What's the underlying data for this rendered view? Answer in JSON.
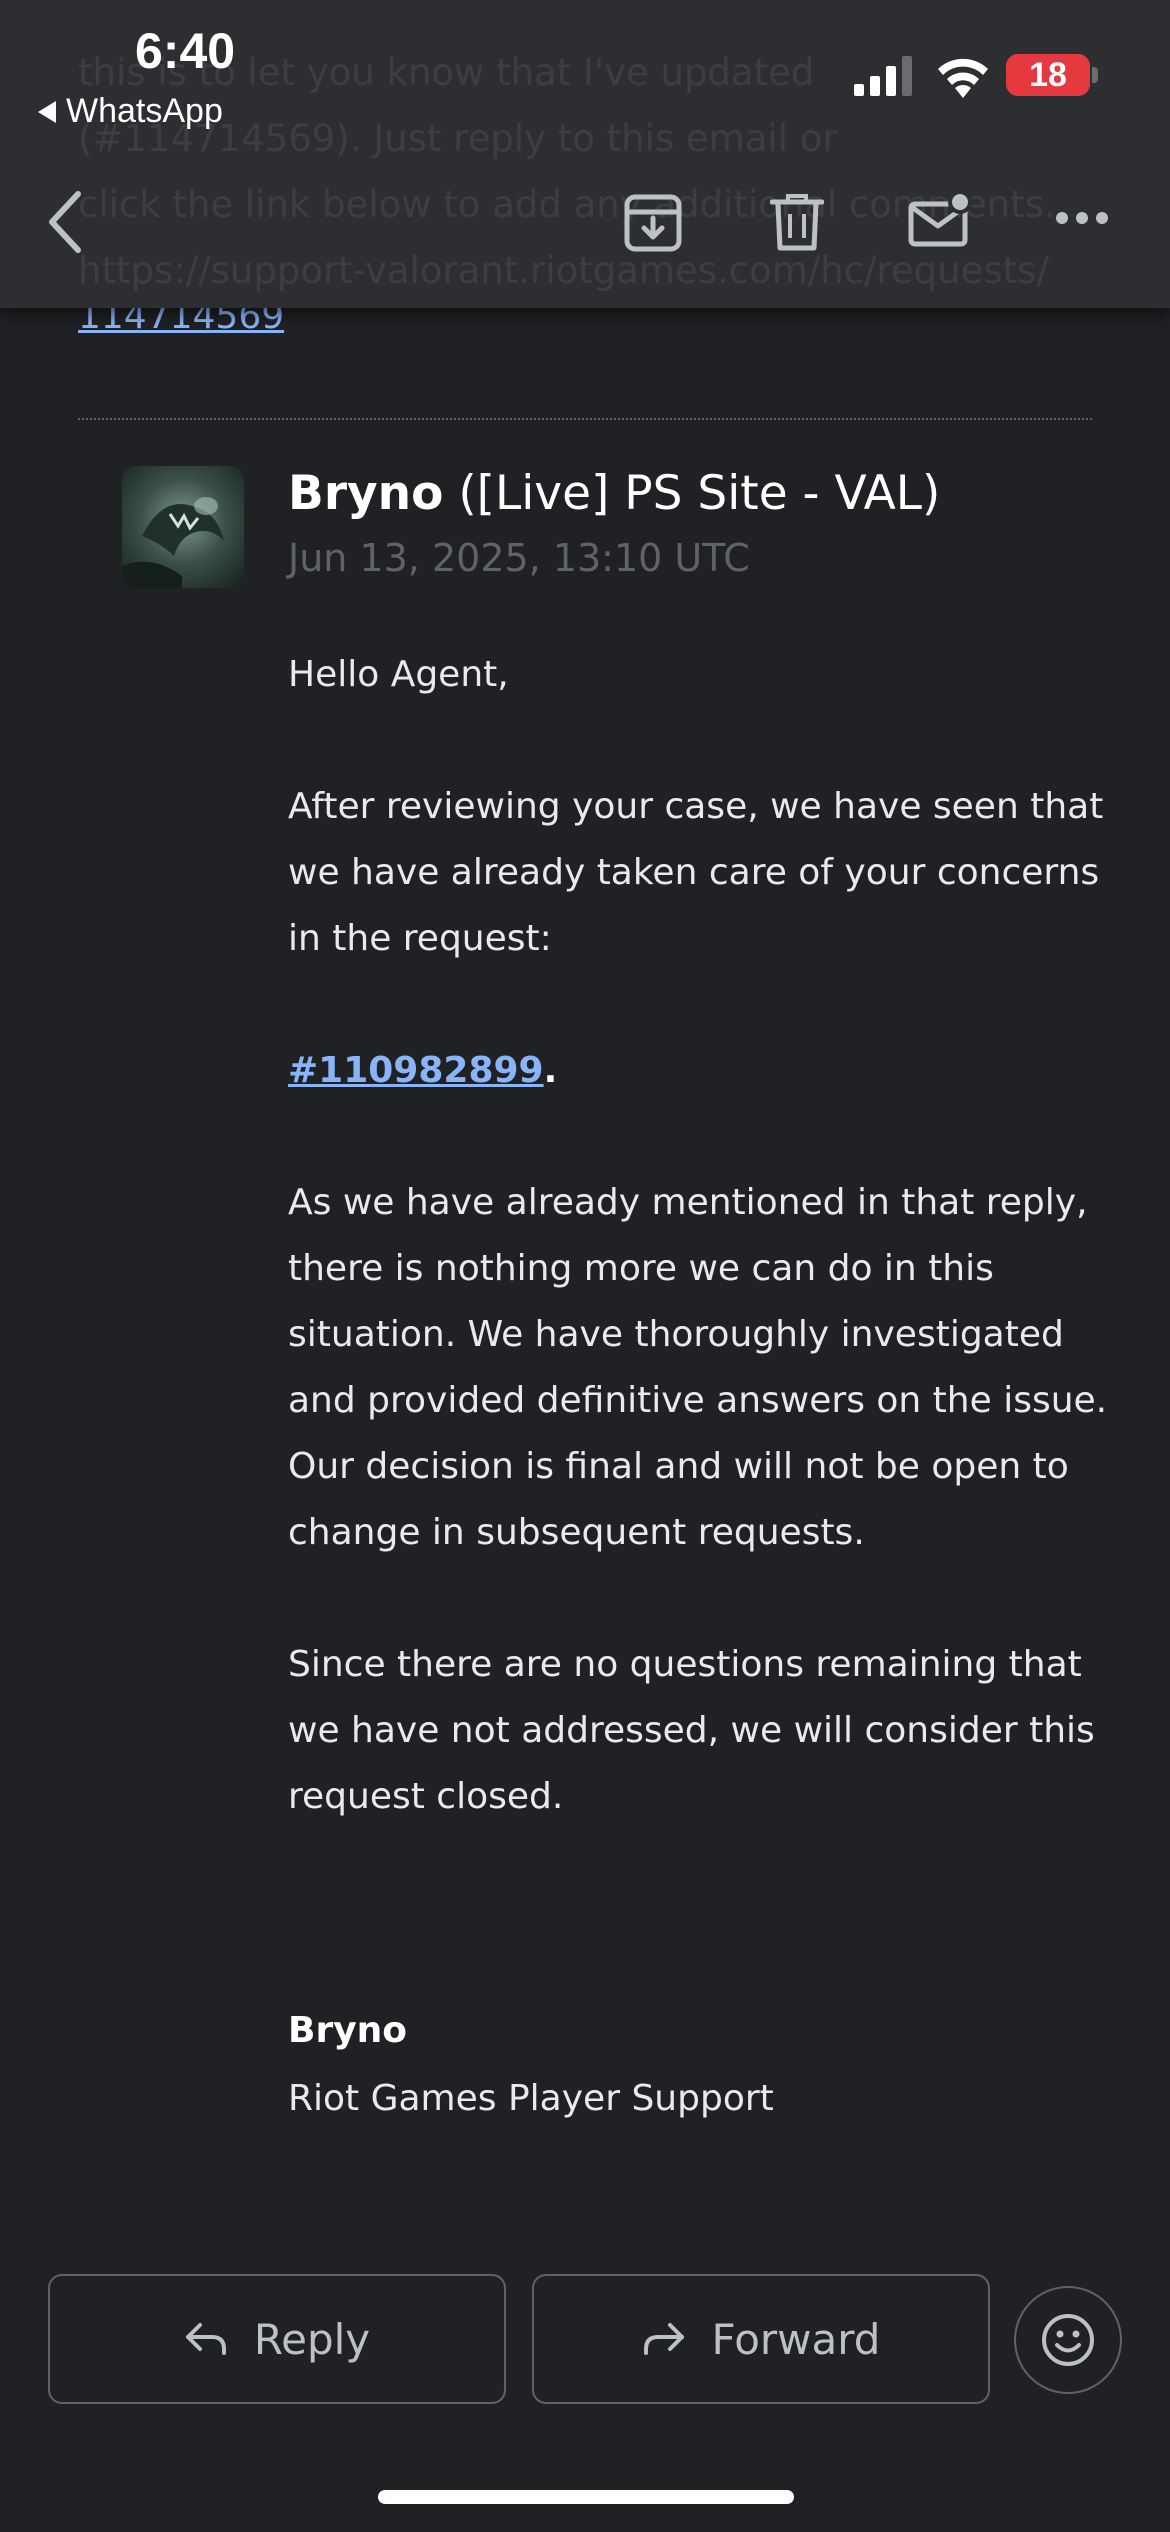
{
  "status_bar": {
    "time": "6:40",
    "back_app": "WhatsApp",
    "battery": "18"
  },
  "behind_text": {
    "line1": "this is to let you know that I've updated",
    "line2": "(#114714569). Just reply to this email or",
    "line3": "click the link below to add any additional comments.",
    "line4": "https://support-valorant.riotgames.com/hc/requests/"
  },
  "prev_link": "114714569",
  "toolbar": {
    "back": "back-icon",
    "archive": "archive-icon",
    "delete": "trash-icon",
    "mark_unread": "mail-unread-icon",
    "more": "more-icon"
  },
  "message": {
    "sender_name": "Bryno",
    "sender_detail": "([Live] PS Site - VAL)",
    "date": "Jun 13, 2025, 13:10 UTC",
    "greeting": "Hello Agent,",
    "para1": "After reviewing your case, we have seen that we have already taken care of your concerns in the request:",
    "request_ref": "#110982899",
    "request_ref_suffix": ".",
    "para2": "As we have already mentioned in that reply, there is nothing more we can do in this situation.  We have thoroughly investigated and provided definitive answers on the issue. Our decision is final and will not be open to change in subsequent requests.",
    "para3": "Since there are no questions remaining that we have not addressed, we will consider this request closed.",
    "signature_name": "Bryno",
    "signature_org": "Riot Games Player Support"
  },
  "actions": {
    "reply": "Reply",
    "forward": "Forward"
  },
  "colors": {
    "background": "#202124",
    "link": "#8ab4f8",
    "battery": "#e5393f"
  }
}
